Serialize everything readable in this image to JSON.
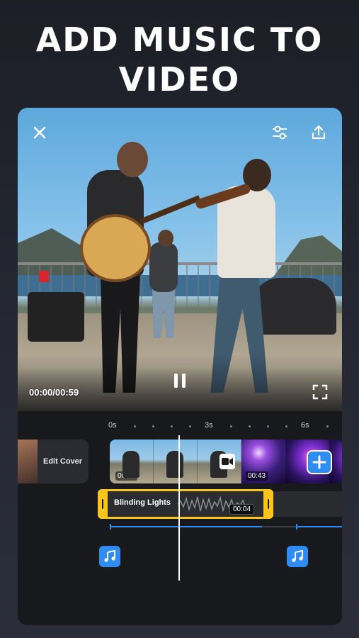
{
  "headline": {
    "line1": "ADD MUSIC TO",
    "line2": "VIDEO"
  },
  "player": {
    "timecode": "00:00/00:59"
  },
  "timeline": {
    "ticks": [
      "0s",
      "3s",
      "6s"
    ],
    "edit_cover_label": "Edit Cover",
    "clips": [
      {
        "time": "00:03"
      },
      {
        "time": "00:43"
      }
    ],
    "music": {
      "title": "Blinding Lights",
      "duration": "00:04"
    }
  },
  "colors": {
    "accent_blue": "#2f8cf5",
    "music_yellow": "#f7c51b",
    "background": "#1d1f27"
  },
  "icons": {
    "close": "close-icon",
    "adjust": "sliders-icon",
    "share": "share-icon",
    "pause": "pause-icon",
    "fullscreen": "fullscreen-icon",
    "add": "plus-icon",
    "music": "music-note-icon",
    "camera": "video-camera-icon"
  }
}
